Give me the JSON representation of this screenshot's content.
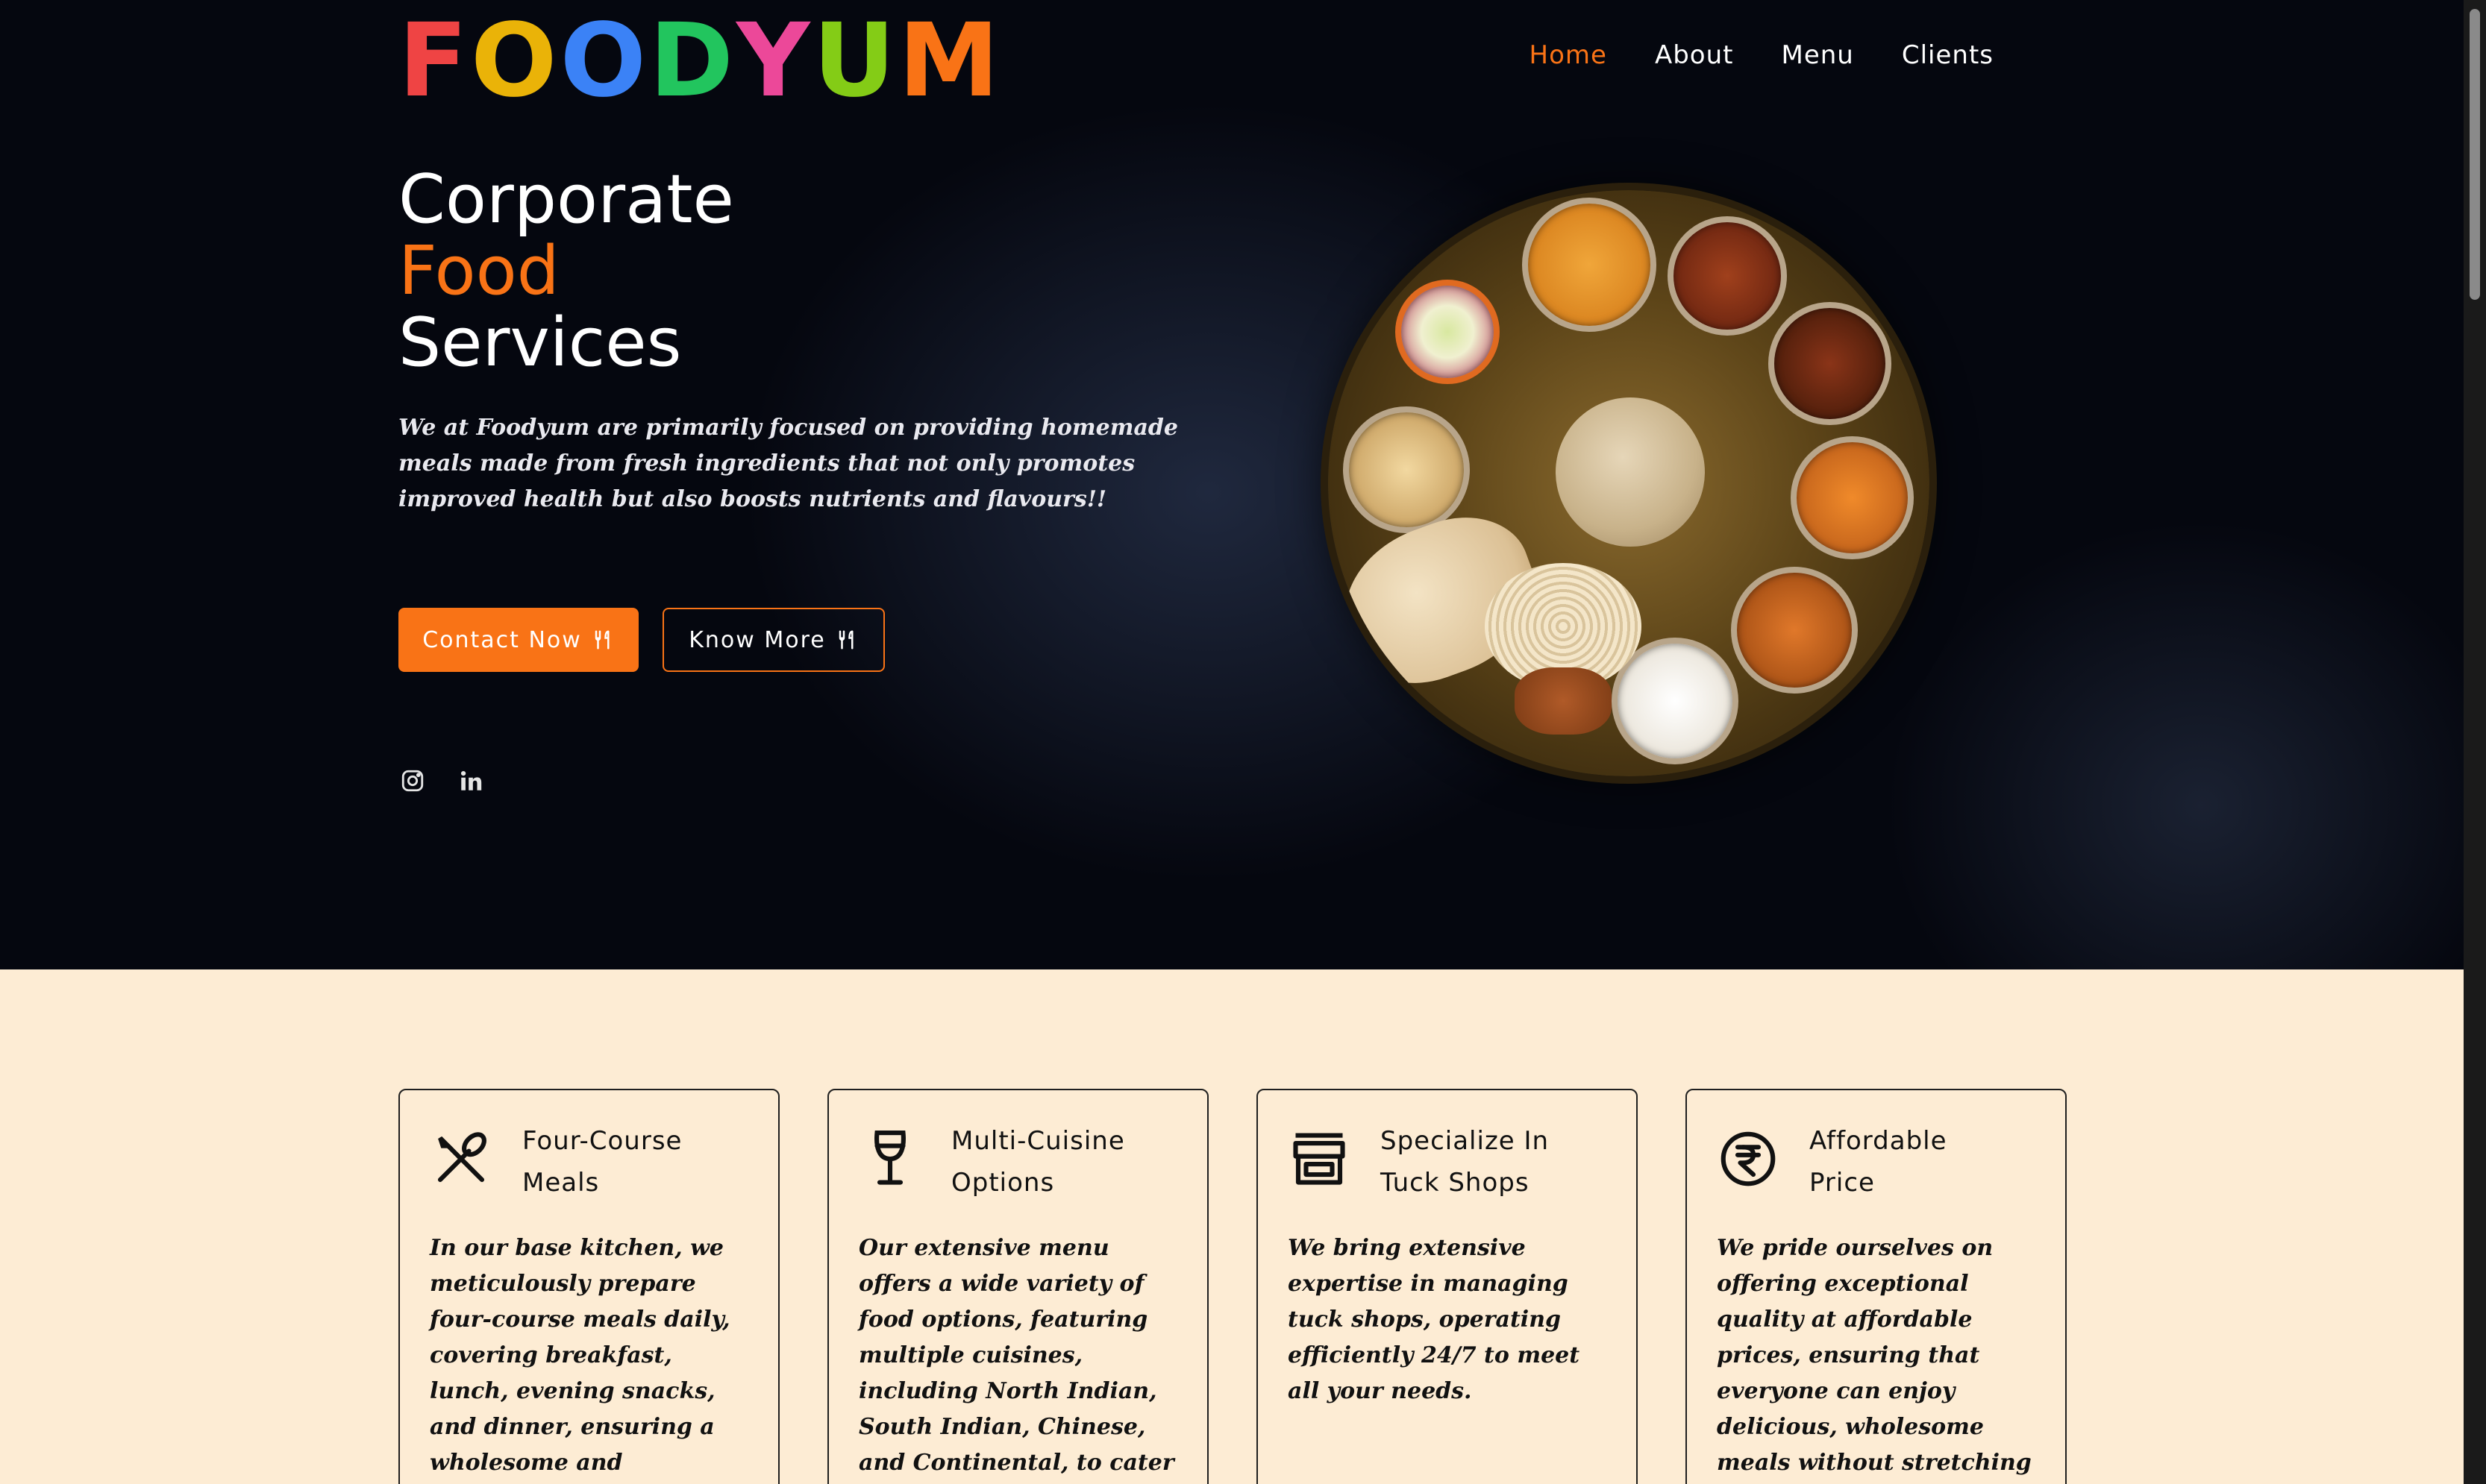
{
  "brand": {
    "letters": [
      {
        "ch": "F",
        "color": "#ef4444"
      },
      {
        "ch": "O",
        "color": "#eab308"
      },
      {
        "ch": "O",
        "color": "#3b82f6"
      },
      {
        "ch": "D",
        "color": "#22c55e"
      },
      {
        "ch": "Y",
        "color": "#ec4899"
      },
      {
        "ch": "U",
        "color": "#84cc16"
      },
      {
        "ch": "M",
        "color": "#f97316"
      }
    ]
  },
  "nav": {
    "home": "Home",
    "about": "About",
    "menu": "Menu",
    "clients": "Clients",
    "active_color": "#f97316"
  },
  "hero": {
    "title_line1": "Corporate",
    "title_line2": "Food",
    "title_line3": "Services",
    "description": "We at Foodyum are primarily focused on providing homemade meals made from fresh ingredients that not only promotes improved health but also boosts nutrients and flavours!!",
    "contact_button": "Contact Now",
    "know_more_button": "Know More",
    "accent_color": "#f97316",
    "social_icons": [
      "instagram-icon",
      "linkedin-icon"
    ]
  },
  "features": [
    {
      "icon": "spoon-knife-icon",
      "title_line1": "Four-Course",
      "title_line2": "Meals",
      "body": "In our base kitchen, we meticulously prepare four-course meals daily, covering breakfast, lunch, evening snacks, and dinner, ensuring a wholesome and satisfying dining experience throughout"
    },
    {
      "icon": "wine-glass-icon",
      "title_line1": "Multi-Cuisine",
      "title_line2": "Options",
      "body": "Our extensive menu offers a wide variety of food options, featuring multiple cuisines, including North Indian, South Indian, Chinese, and Continental, to cater to diverse tastes and preferences."
    },
    {
      "icon": "shop-icon",
      "title_line1": "Specialize In",
      "title_line2": "Tuck Shops",
      "body": "We bring extensive expertise in managing tuck shops, operating efficiently 24/7 to meet all your needs."
    },
    {
      "icon": "rupee-icon",
      "title_line1": "Affordable",
      "title_line2": "Price",
      "body": "We pride ourselves on offering exceptional quality at affordable prices, ensuring that everyone can enjoy delicious, wholesome meals without stretching their budget. Quality dining"
    }
  ]
}
